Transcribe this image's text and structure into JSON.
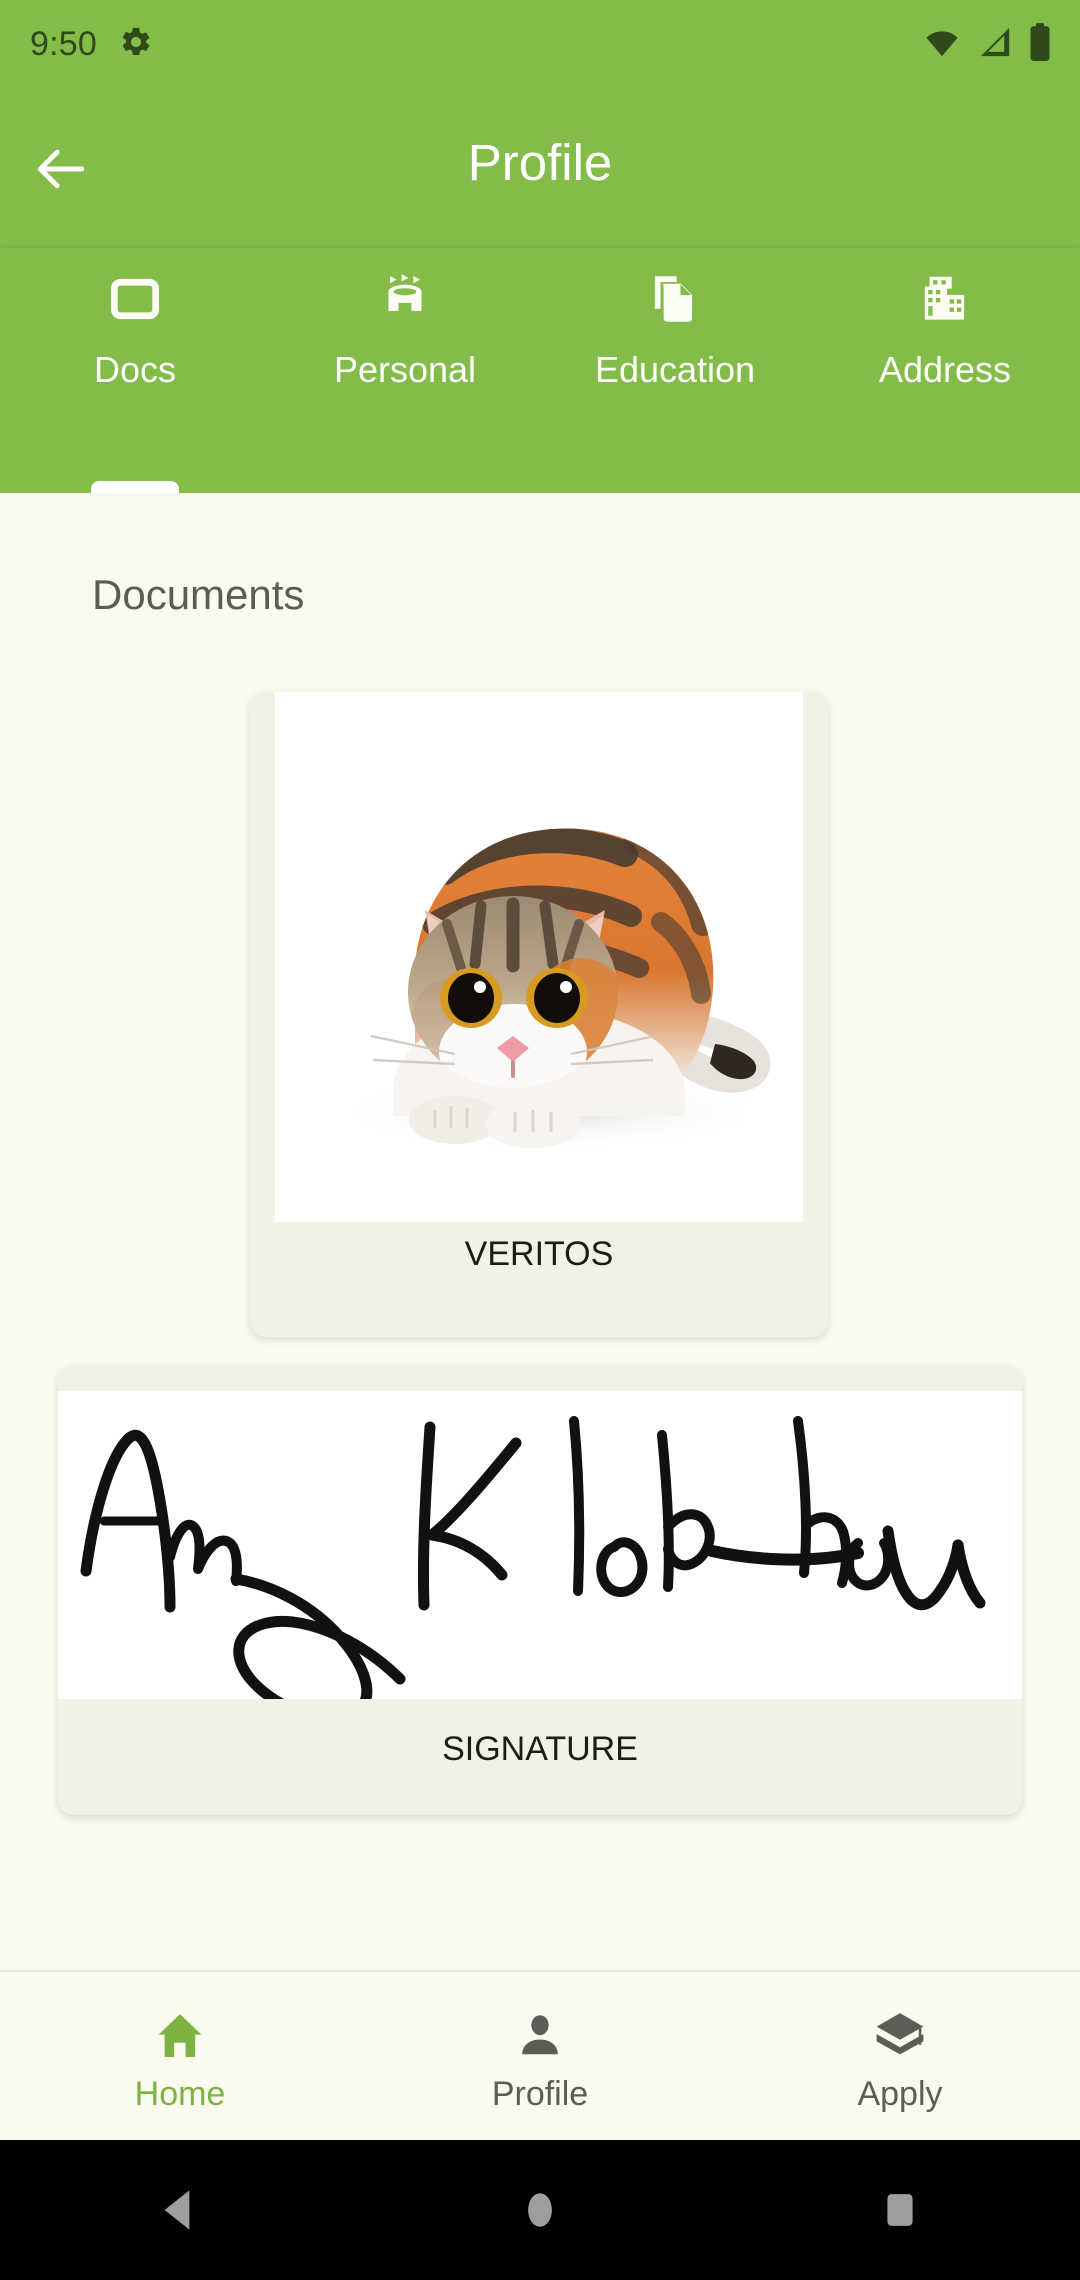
{
  "status_bar": {
    "time": "9:50",
    "icons": [
      "gear-icon",
      "wifi-icon",
      "cellular-signal-icon",
      "battery-icon"
    ],
    "background_color": "#84BC49",
    "icon_color": "#2F4A18"
  },
  "app_bar": {
    "title": "Profile",
    "back_icon": "arrow-left-icon",
    "background_color": "#84BC49",
    "title_color": "#FFFFFF"
  },
  "tabs": {
    "active_index": 0,
    "items": [
      {
        "label": "Docs",
        "icon": "rounded-rect-card-icon"
      },
      {
        "label": "Personal",
        "icon": "person-head-icon"
      },
      {
        "label": "Education",
        "icon": "copy-documents-icon"
      },
      {
        "label": "Address",
        "icon": "buildings-icon"
      }
    ]
  },
  "main": {
    "section_title": "Documents",
    "background_color": "#FBFAEF",
    "card_color": "#F0F2E6",
    "documents": [
      {
        "label": "VERITOS",
        "image": "calico-cat-photo"
      },
      {
        "label": "SIGNATURE",
        "image": "handwritten-signature"
      }
    ]
  },
  "bottom_nav": {
    "active_index": 0,
    "active_color": "#7CB342",
    "inactive_color": "#5D5D58",
    "items": [
      {
        "label": "Home",
        "icon": "home-icon"
      },
      {
        "label": "Profile",
        "icon": "person-icon"
      },
      {
        "label": "Apply",
        "icon": "graduation-cap-icon"
      }
    ]
  },
  "system_nav": {
    "background_color": "#000000",
    "icon_color": "#9E9E9E",
    "buttons": [
      {
        "name": "back",
        "icon": "triangle-back-icon"
      },
      {
        "name": "home",
        "icon": "circle-home-icon"
      },
      {
        "name": "recents",
        "icon": "square-recents-icon"
      }
    ]
  }
}
